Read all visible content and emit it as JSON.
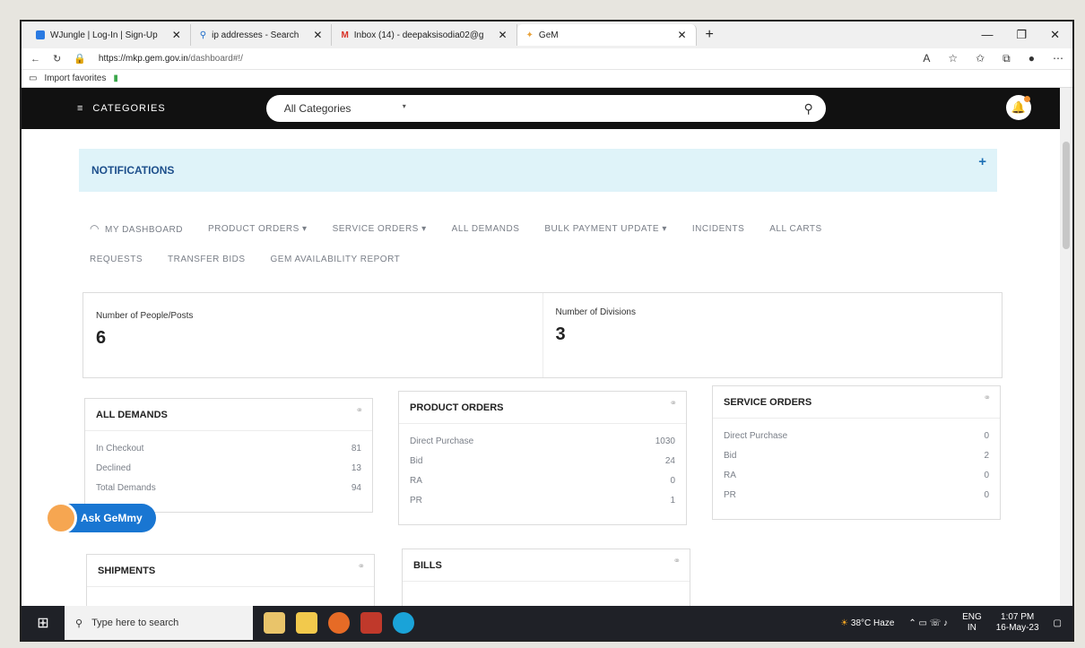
{
  "browser": {
    "tabs": [
      {
        "label": "WJungle | Log-In | Sign-Up",
        "color": "#2a7ae2"
      },
      {
        "label": "ip addresses - Search",
        "color": "#1b6ac9"
      },
      {
        "label": "Inbox (14) - deepaksisodia02@g",
        "color": "#d93025"
      },
      {
        "label": "GeM",
        "color": "#e8a33d"
      }
    ],
    "new_tab": "+",
    "url_host": "https://mkp.gem.gov.in",
    "url_path": "/dashboard#!/",
    "favorites": [
      "Import favorites"
    ]
  },
  "header": {
    "categories_label": "CATEGORIES",
    "search_category": "All Categories"
  },
  "notifications": {
    "title": "NOTIFICATIONS",
    "plus": "+"
  },
  "menu": {
    "row1": [
      "MY DASHBOARD",
      "PRODUCT ORDERS ▾",
      "SERVICE ORDERS ▾",
      "ALL DEMANDS",
      "BULK PAYMENT UPDATE ▾",
      "INCIDENTS",
      "ALL CARTS"
    ],
    "row2": [
      "REQUESTS",
      "TRANSFER BIDS",
      "GEM AVAILABILITY REPORT"
    ]
  },
  "stats": {
    "people_label": "Number of People/Posts",
    "people_value": "6",
    "divisions_label": "Number of Divisions",
    "divisions_value": "3"
  },
  "cards": {
    "all_demands": {
      "title": "ALL DEMANDS",
      "rows": [
        {
          "label": "In Checkout",
          "value": "81"
        },
        {
          "label": "Declined",
          "value": "13"
        },
        {
          "label": "Total Demands",
          "value": "94"
        }
      ]
    },
    "product_orders": {
      "title": "PRODUCT ORDERS",
      "rows": [
        {
          "label": "Direct Purchase",
          "value": "1030"
        },
        {
          "label": "Bid",
          "value": "24"
        },
        {
          "label": "RA",
          "value": "0"
        },
        {
          "label": "PR",
          "value": "1"
        }
      ]
    },
    "service_orders": {
      "title": "SERVICE ORDERS",
      "rows": [
        {
          "label": "Direct Purchase",
          "value": "0"
        },
        {
          "label": "Bid",
          "value": "2"
        },
        {
          "label": "RA",
          "value": "0"
        },
        {
          "label": "PR",
          "value": "0"
        }
      ]
    },
    "shipments": {
      "title": "SHIPMENTS"
    },
    "bills": {
      "title": "BILLS"
    }
  },
  "chatbot": {
    "label": "Ask GeMmy"
  },
  "taskbar": {
    "search_placeholder": "Type here to search",
    "weather": "38°C Haze",
    "lang": "ENG",
    "lang2": "IN",
    "time": "1:07 PM",
    "date": "16-May-23"
  }
}
